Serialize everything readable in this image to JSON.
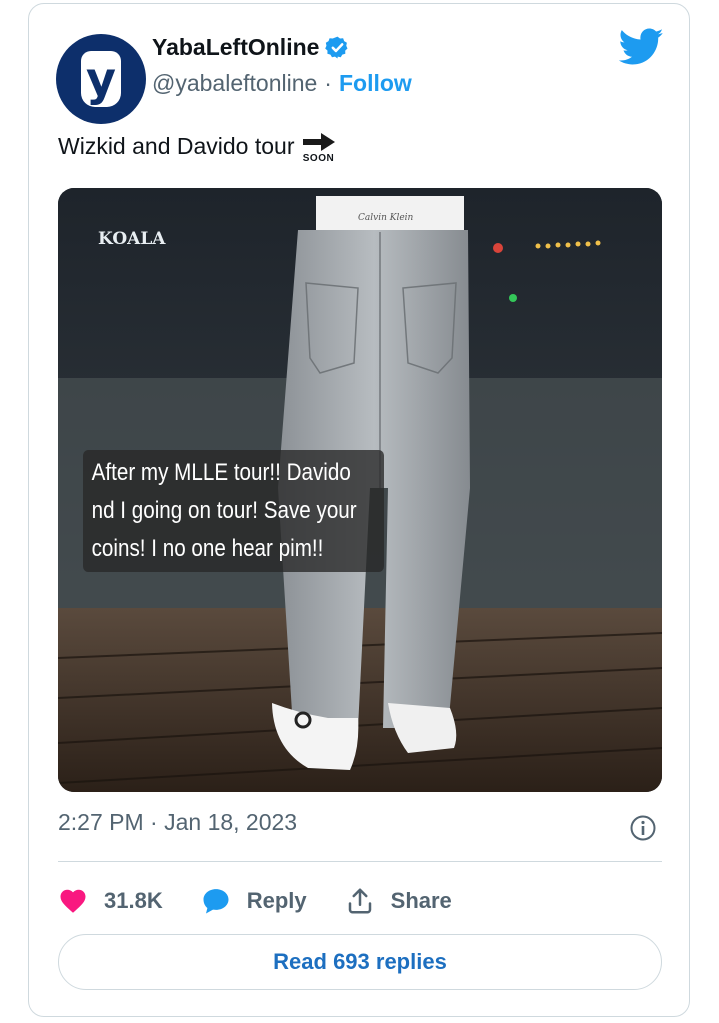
{
  "tweet": {
    "author": {
      "display_name": "YabaLeftOnline",
      "handle": "@yabaleftonline",
      "avatar_letter": "y",
      "verified": true
    },
    "separator": "·",
    "follow_label": "Follow",
    "text": "Wizkid and Davido tour",
    "soon_label": "SOON",
    "media": {
      "overlay_text": "After my MLLE tour!! Davido nd I going on tour! Save your coins! I no one hear pim!!",
      "underwear_brand_text": "Calvin Klein",
      "sign_text": "KOALA"
    },
    "timestamp": "2:27 PM · Jan 18, 2023",
    "likes_count": "31.8K",
    "reply_label": "Reply",
    "share_label": "Share",
    "read_replies_label": "Read 693 replies"
  },
  "colors": {
    "brand_blue": "#1d9bf0",
    "like_pink": "#f91880",
    "avatar_bg": "#0d2f6b",
    "secondary_text": "#536471",
    "border": "#cfd9de"
  },
  "icons": [
    "verified-badge-icon",
    "twitter-bird-icon",
    "soon-arrow-icon",
    "info-icon",
    "heart-icon",
    "reply-bubble-icon",
    "share-icon"
  ]
}
